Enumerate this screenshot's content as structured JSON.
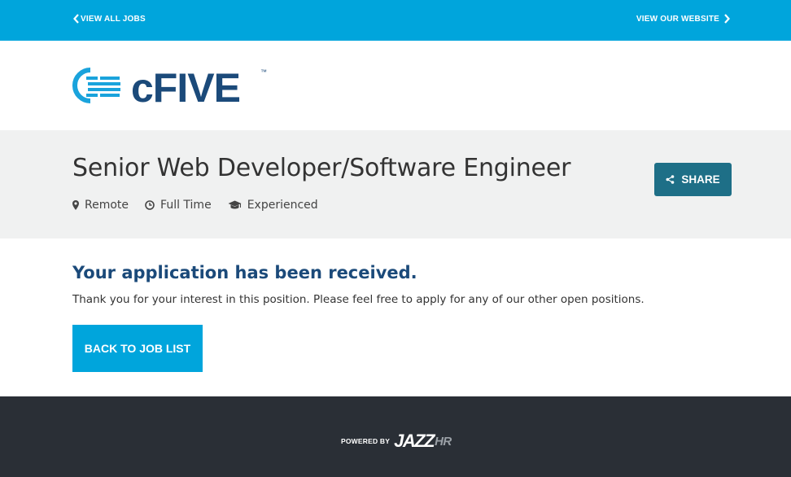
{
  "topbar": {
    "left_link": "VIEW ALL JOBS",
    "right_link": "VIEW OUR WEBSITE",
    "color": "#00a5dc"
  },
  "brand": {
    "logo_text": "cFIVE",
    "logo_icon": "cfive-logo-icon",
    "trademark": "™",
    "color": "#1b4a7a"
  },
  "job": {
    "title": "Senior Web Developer/Software Engineer",
    "location": "Remote",
    "type": "Full Time",
    "experience": "Experienced",
    "share_label": "SHARE",
    "share_color": "#1e6f87"
  },
  "confirmation": {
    "title": "Your application has been received.",
    "message": "Thank you for your interest in this position. Please feel free to apply for any of our other open positions.",
    "back_label": "BACK TO JOB LIST"
  },
  "footer": {
    "powered_by": "POWERED BY",
    "brand_main": "JAZZ",
    "brand_suffix": "HR"
  }
}
